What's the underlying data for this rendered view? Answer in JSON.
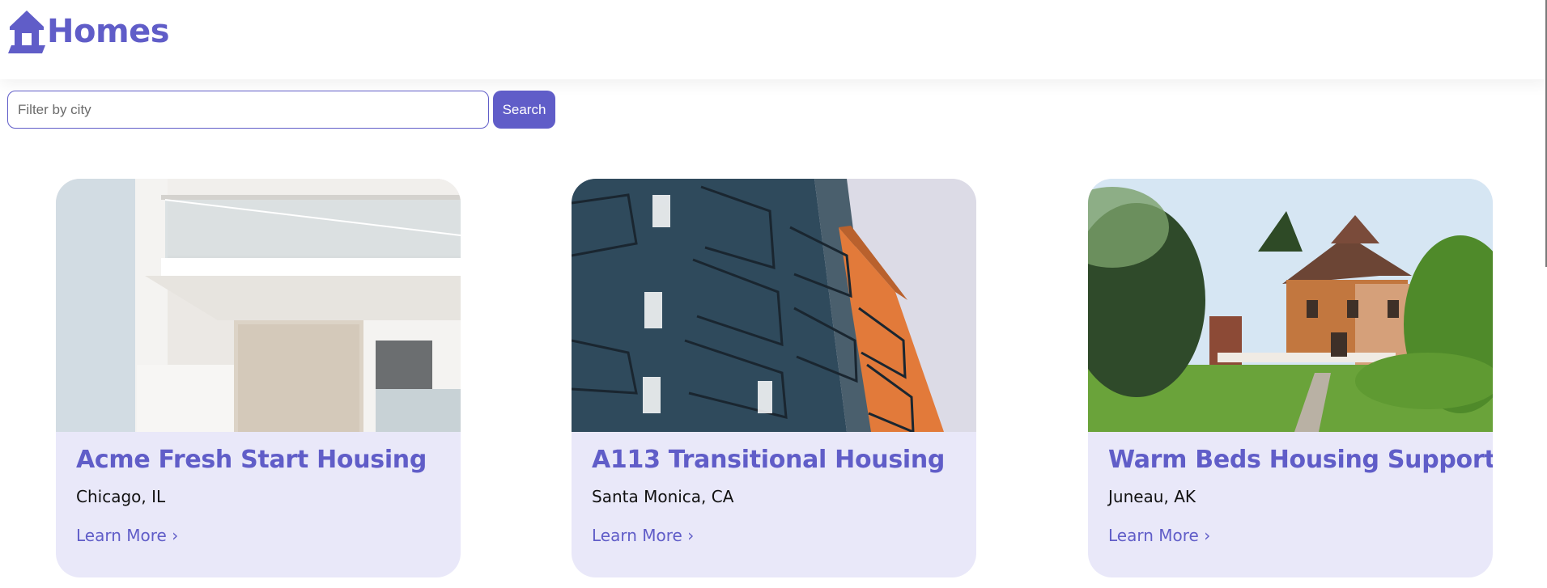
{
  "header": {
    "brand_name": "Homes",
    "logo_icon": "house-icon",
    "brand_color": "#605dc8"
  },
  "search": {
    "placeholder": "Filter by city",
    "value": "",
    "button_label": "Search"
  },
  "listings": [
    {
      "title": "Acme Fresh Start Housing",
      "location": "Chicago, IL",
      "link_label": "Learn More ›",
      "photo": "white-modern-apartment-balconies"
    },
    {
      "title": "A113 Transitional Housing",
      "location": "Santa Monica, CA",
      "link_label": "Learn More ›",
      "photo": "blue-orange-apartment-balconies"
    },
    {
      "title": "Warm Beds Housing Support",
      "location": "Juneau, AK",
      "link_label": "Learn More ›",
      "photo": "brick-victorian-house-with-trees"
    }
  ],
  "colors": {
    "accent": "#605dc8",
    "card_background": "#e9e8f9"
  }
}
